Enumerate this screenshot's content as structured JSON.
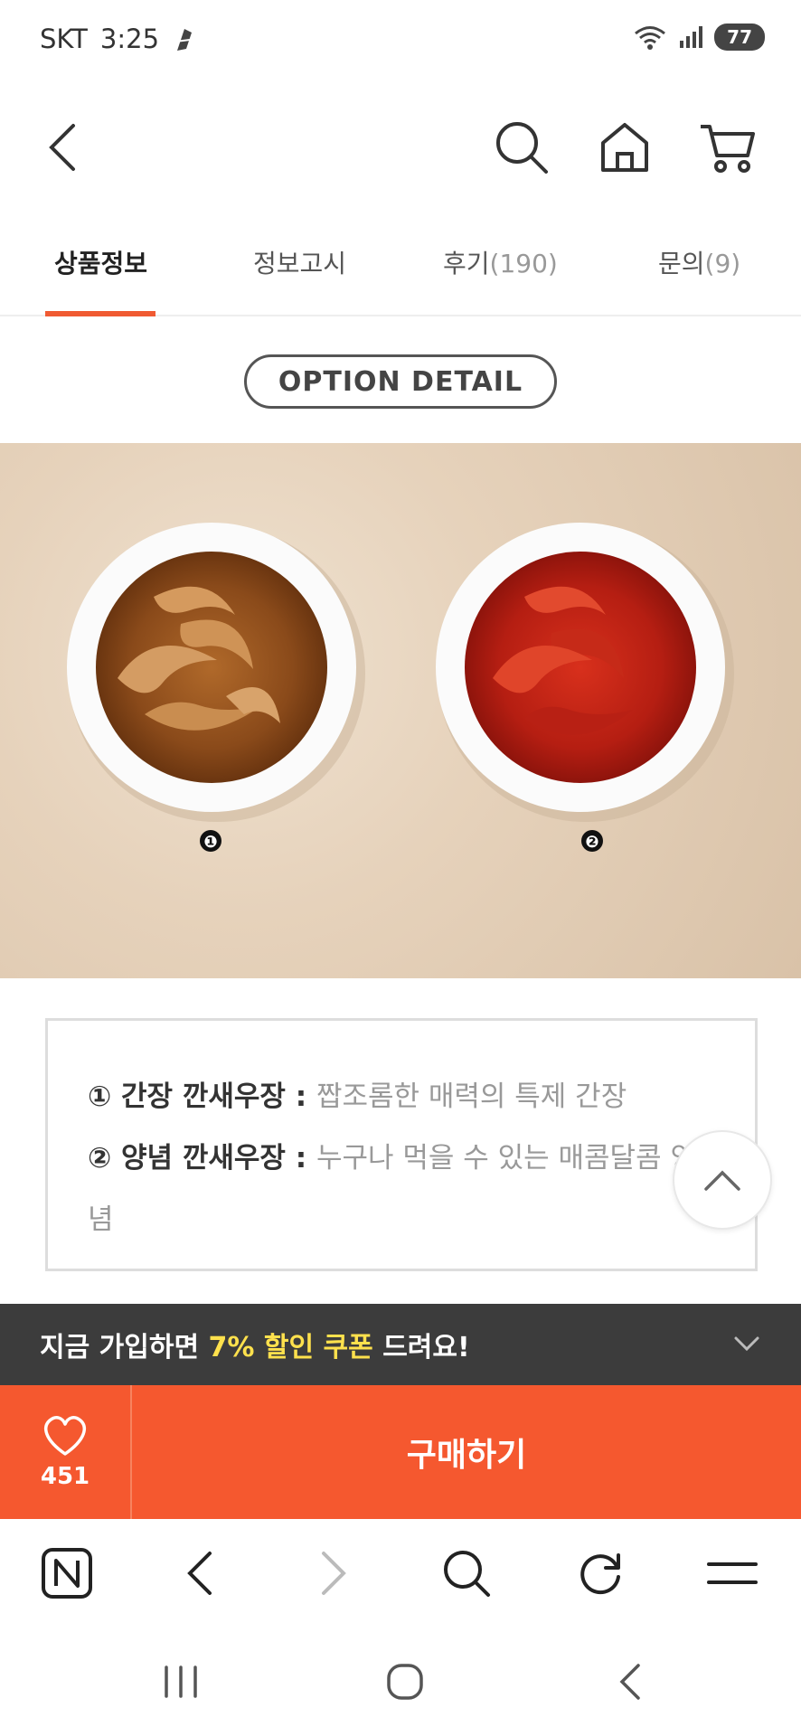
{
  "status_bar": {
    "carrier": "SKT",
    "time": "3:25",
    "battery": "77"
  },
  "header": {
    "icons": [
      "back-icon",
      "search-icon",
      "home-icon",
      "cart-icon"
    ]
  },
  "tabs": [
    {
      "label": "상품정보",
      "count": ""
    },
    {
      "label": "정보고시",
      "count": ""
    },
    {
      "label": "후기",
      "count": "(190)"
    },
    {
      "label": "문의",
      "count": "(9)"
    }
  ],
  "option_detail": "OPTION DETAIL",
  "product_image": {
    "markers": [
      "❶",
      "❷"
    ]
  },
  "info": [
    {
      "label": "① 간장 깐새우장 : ",
      "desc": "짭조롬한 매력의 특제 간장"
    },
    {
      "label": "② 양념 깐새우장 : ",
      "desc": "누구나 먹을 수 있는 매콤달콤 양념"
    }
  ],
  "coupon_banner": {
    "prefix": "지금 가입하면 ",
    "highlight": "7% 할인 쿠폰",
    "suffix": " 드려요!"
  },
  "purchase": {
    "wish_count": "451",
    "buy_label": "구매하기"
  },
  "browser_toolbar": {
    "icons": [
      "naver-icon",
      "back-icon",
      "forward-icon",
      "search-icon",
      "refresh-icon",
      "menu-icon"
    ]
  },
  "colors": {
    "accent": "#f5582f",
    "banner": "#3c3c3c",
    "highlight": "#ffe14d"
  }
}
